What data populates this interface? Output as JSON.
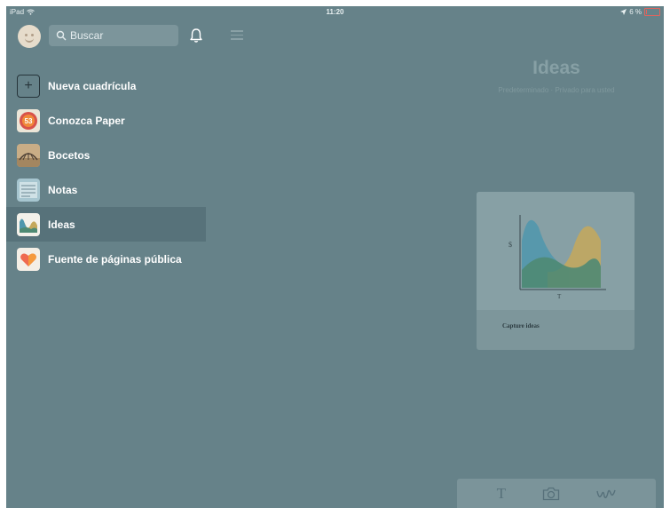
{
  "status_bar": {
    "device": "iPad",
    "time": "11:20",
    "battery_text": "6 %"
  },
  "search": {
    "placeholder": "Buscar"
  },
  "sidebar": {
    "items": [
      {
        "label": "Nueva cuadrícula",
        "icon": "plus-icon"
      },
      {
        "label": "Conozca Paper",
        "icon": "paper-badge-icon",
        "badge": "53"
      },
      {
        "label": "Bocetos",
        "icon": "sketch-cover-icon"
      },
      {
        "label": "Notas",
        "icon": "notes-cover-icon"
      },
      {
        "label": "Ideas",
        "icon": "ideas-cover-icon",
        "selected": true
      },
      {
        "label": "Fuente de páginas pública",
        "icon": "heart-cover-icon"
      }
    ]
  },
  "space": {
    "title": "Ideas",
    "subtitle": "Predeterminado · Privado para usted"
  },
  "card": {
    "caption": "Capture ideas",
    "thumb_y_label": "$",
    "thumb_x_label": "T"
  },
  "toolbar": {
    "tools": [
      "text-tool-icon",
      "camera-icon",
      "draw-tool-icon"
    ],
    "text_glyph": "T"
  },
  "colors": {
    "background": "#668289",
    "selected_row": "#57727a",
    "battery": "#e0655e",
    "chart_blue": "#4f97ad",
    "chart_yellow": "#c5a85b",
    "chart_green": "#4f8a73"
  }
}
